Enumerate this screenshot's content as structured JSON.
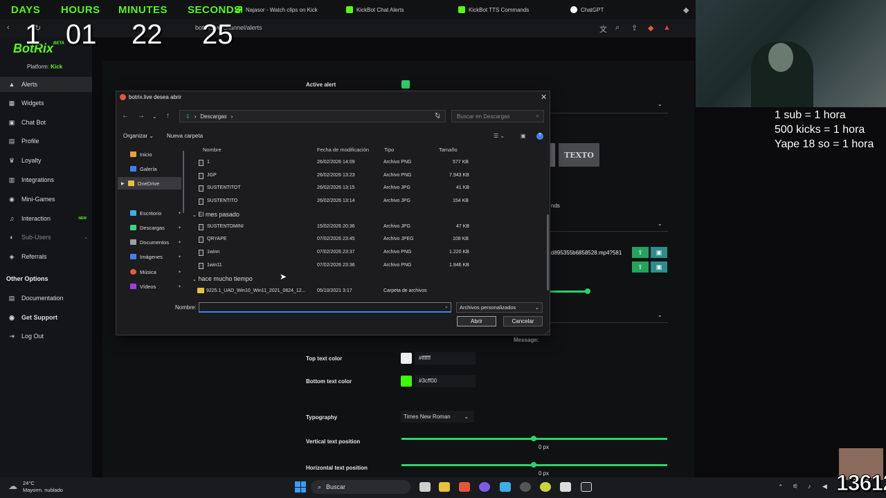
{
  "countdown": {
    "labels": [
      "DAYS",
      "HOURS",
      "MINUTES",
      "SECONDS"
    ],
    "values": [
      "1",
      "01",
      "22",
      "25"
    ]
  },
  "browser": {
    "tabs": [
      "Najasor - Watch clips on Kick",
      "KickBot Chat Alerts",
      "KickBot TTS Commands",
      "ChatGPT"
    ],
    "address": "botrix.live/channel/alerts"
  },
  "sidebar": {
    "logo": "BotRix",
    "logo_badge": "BETA",
    "platform_label": "Platform:",
    "platform_value": "Kick",
    "items": [
      {
        "label": "Alerts",
        "icon": "bell-icon"
      },
      {
        "label": "Widgets",
        "icon": "widgets-icon"
      },
      {
        "label": "Chat Bot",
        "icon": "bot-icon"
      },
      {
        "label": "Profile",
        "icon": "profile-icon"
      },
      {
        "label": "Loyalty",
        "icon": "trophy-icon"
      },
      {
        "label": "Integrations",
        "icon": "plug-icon"
      },
      {
        "label": "Mini-Games",
        "icon": "gamepad-icon"
      },
      {
        "label": "Interaction",
        "icon": "music-icon",
        "badge": "NEW"
      },
      {
        "label": "Sub-Users",
        "icon": "users-icon"
      },
      {
        "label": "Referrals",
        "icon": "referral-icon"
      }
    ],
    "other_title": "Other Options",
    "other_items": [
      {
        "label": "Documentation",
        "icon": "doc-icon"
      },
      {
        "label": "Get Support",
        "icon": "support-icon"
      },
      {
        "label": "Log Out",
        "icon": "logout-icon"
      }
    ]
  },
  "settings": {
    "active_alert": "Active alert",
    "texto_label": "TEXTO",
    "sounds_fragment": "nds",
    "file_name": "d895355b6858528.mp4?581",
    "message_label": "Message:",
    "top_text_color_label": "Top text color",
    "top_text_color": "#ffffff",
    "bottom_text_color_label": "Bottom text color",
    "bottom_text_color": "#3cff00",
    "typography_label": "Typography",
    "typography_value": "Times New Roman",
    "vertical_label": "Vertical text position",
    "vertical_value": "0 px",
    "horizontal_label": "Horizontal text position",
    "horizontal_value": "0 px"
  },
  "dialog": {
    "title": "botrix.live desea abrir",
    "path": "Descargas",
    "search_placeholder": "Buscar en Descargas",
    "organize": "Organizar",
    "new_folder": "Nueva carpeta",
    "tree": [
      {
        "label": "Inicio",
        "color": "#e8a23b"
      },
      {
        "label": "Galería",
        "color": "#3b82f6"
      },
      {
        "label": "OneDrive",
        "color": "#e8c23b"
      },
      {
        "label": "Escritorio",
        "color": "#3bb0e8"
      },
      {
        "label": "Descargas",
        "color": "#3bd37b"
      },
      {
        "label": "Documentos",
        "color": "#9aa0a6"
      },
      {
        "label": "Imágenes",
        "color": "#3b82f6"
      },
      {
        "label": "Música",
        "color": "#e85a3b"
      },
      {
        "label": "Vídeos",
        "color": "#a03be8"
      }
    ],
    "columns": [
      "Nombre",
      "Fecha de modificación",
      "Tipo",
      "Tamaño"
    ],
    "groups": [
      "El mes pasado",
      "hace mucho tiempo"
    ],
    "files_recent": [
      {
        "name": "1",
        "date": "26/02/2026 14:09",
        "type": "Archivo PNG",
        "size": "577 KB"
      },
      {
        "name": "JGP",
        "date": "26/02/2026 13:23",
        "type": "Archivo PNG",
        "size": "7.943 KB"
      },
      {
        "name": "SUSTENTITOT",
        "date": "26/02/2026 13:15",
        "type": "Archivo JPG",
        "size": "41 KB"
      },
      {
        "name": "SUSTENTITO",
        "date": "26/02/2026 13:14",
        "type": "Archivo JPG",
        "size": "154 KB"
      }
    ],
    "files_last_month": [
      {
        "name": "SUSTENTOMINI",
        "date": "15/02/2026 20:36",
        "type": "Archivo JPG",
        "size": "47 KB"
      },
      {
        "name": "QRYAPE",
        "date": "07/02/2026 23:45",
        "type": "Archivo JPEG",
        "size": "108 KB"
      },
      {
        "name": "1winn",
        "date": "07/02/2026 23:37",
        "type": "Archivo PNG",
        "size": "1.220 KB"
      },
      {
        "name": "1win11",
        "date": "07/02/2026 23:36",
        "type": "Archivo PNG",
        "size": "1.946 KB"
      }
    ],
    "files_old": [
      {
        "name": "9225.1_UAD_Win10_Win11_2021_0824_12...",
        "date": "05/10/2021 3:17",
        "type": "Carpeta de archivos",
        "size": ""
      }
    ],
    "name_label": "Nombre:",
    "filetype": "Archivos personalizados",
    "open": "Abrir",
    "cancel": "Cancelar"
  },
  "stream_overlay": {
    "goals": [
      "1 sub = 1 hora",
      "500 kicks = 1 hora",
      "Yape 18 so = 1 hora"
    ],
    "counter": "13612"
  },
  "taskbar": {
    "temperature": "24°C",
    "weather": "Mayorm. nublado",
    "search": "Buscar"
  }
}
